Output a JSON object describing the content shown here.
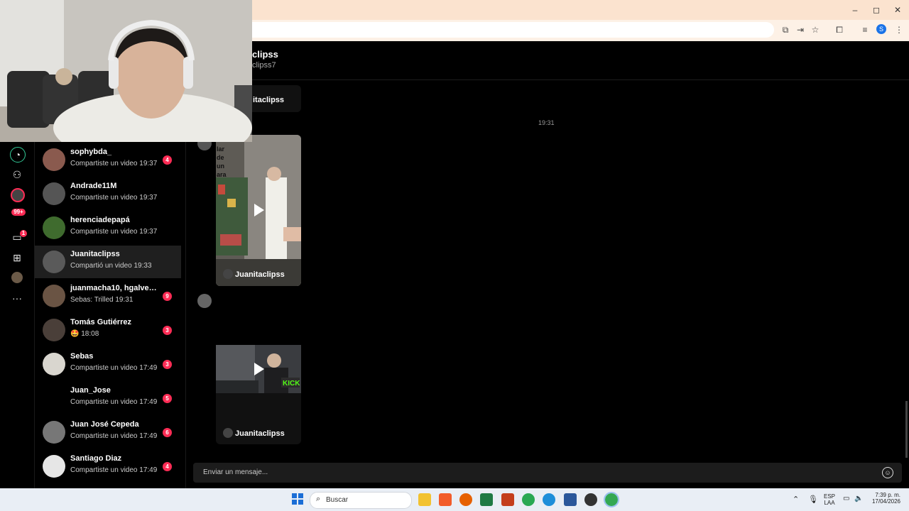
{
  "browser": {
    "minimize": "–",
    "maximize": "◻",
    "close": "✕",
    "profile_initial": "S"
  },
  "chat": {
    "name": "clipss",
    "handle": "clipss7",
    "prev_author": "itaclipss",
    "time_label": "19:31",
    "video1_overlay_text": [
      "lar",
      "de",
      "un",
      "ara"
    ],
    "video1_author": "Juanitaclipss",
    "video2_author": "Juanitaclipss",
    "input_placeholder": "Enviar un mensaje..."
  },
  "rail": {
    "notifications_badge": "99+",
    "messages_badge": "1"
  },
  "conversations": [
    {
      "name": "sophybda_",
      "message": "Compartiste un video 19:37",
      "count": "4"
    },
    {
      "name": "Andrade11M",
      "message": "Compartiste un video 19:37",
      "count": ""
    },
    {
      "name": "herenciadepapá",
      "message": "Compartiste un video 19:37",
      "count": ""
    },
    {
      "name": "Juanitaclipss",
      "message": "Compartió un video 19:33",
      "count": ""
    },
    {
      "name": "juanmacha10, hgalvep...",
      "message": "Sebas: Trilled 19:31",
      "count": "9"
    },
    {
      "name": "Tomás Gutiérrez",
      "message": "🤩 18:08",
      "count": "3"
    },
    {
      "name": "Sebas",
      "message": "Compartiste un video 17:49",
      "count": "3"
    },
    {
      "name": "Juan_Jose",
      "message": "Compartiste un video 17:49",
      "count": "5"
    },
    {
      "name": "Juan José Cepeda",
      "message": "Compartiste un video 17:49",
      "count": "6"
    },
    {
      "name": "Santiago Diaz",
      "message": "Compartiste un video 17:49",
      "count": "4"
    }
  ],
  "taskbar": {
    "search_label": "Buscar",
    "language_line1": "ESP",
    "language_line2": "LAA",
    "time": "7:39 p. m.",
    "date": "17/04/2026"
  }
}
